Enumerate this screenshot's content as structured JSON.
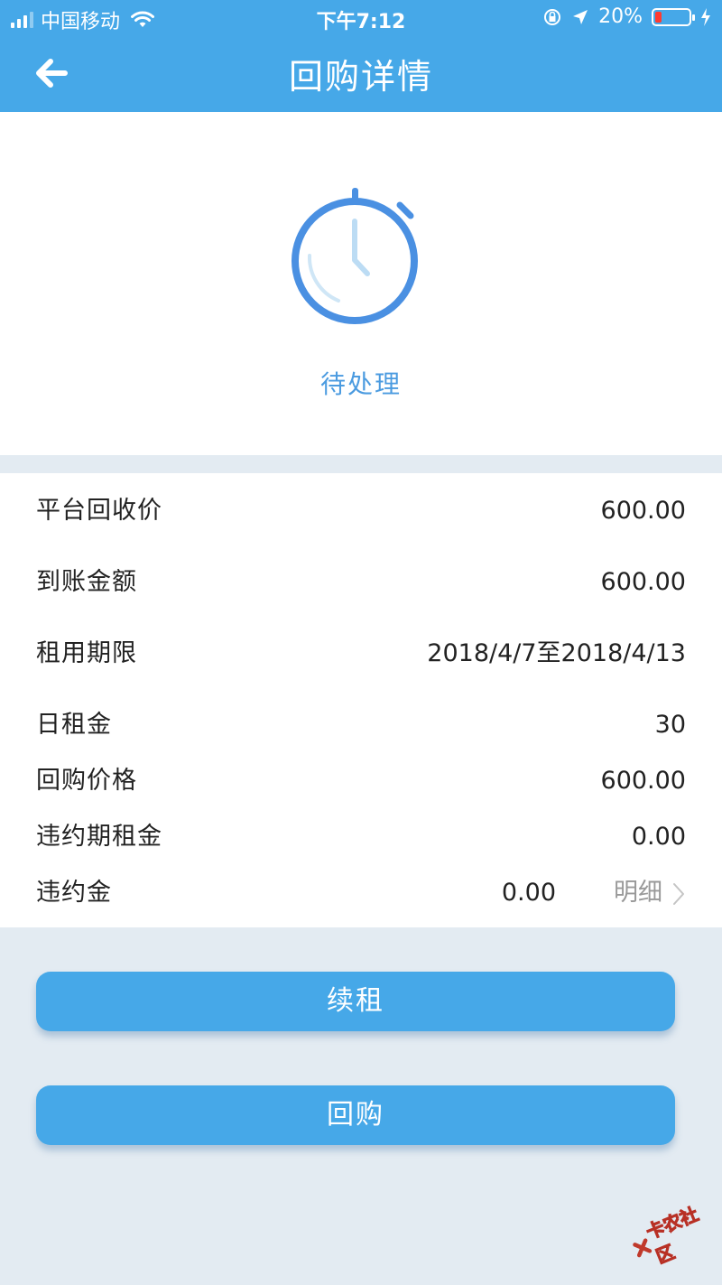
{
  "status_bar": {
    "carrier": "中国移动",
    "time": "下午7:12",
    "battery_percent": "20%",
    "battery_level": 0.2
  },
  "navbar": {
    "title": "回购详情"
  },
  "status_card": {
    "status_text": "待处理"
  },
  "details": {
    "recycle_price": {
      "label": "平台回收价",
      "value": "600.00"
    },
    "received_amount": {
      "label": "到账金额",
      "value": "600.00"
    },
    "rental_period": {
      "label": "租用期限",
      "value": "2018/4/7至2018/4/13"
    },
    "daily_rent": {
      "label": "日租金",
      "value": "30"
    },
    "buyback_price": {
      "label": "回购价格",
      "value": "600.00"
    },
    "overdue_rent": {
      "label": "违约期租金",
      "value": "0.00"
    },
    "penalty": {
      "label": "违约金",
      "value": "0.00",
      "link_label": "明细"
    }
  },
  "actions": {
    "renew_label": "续租",
    "buyback_label": "回购"
  },
  "watermark": {
    "text": "卡农社区"
  },
  "colors": {
    "primary": "#46a8e8",
    "status_text": "#4b9be0",
    "page_bg": "#e3ebf2"
  }
}
